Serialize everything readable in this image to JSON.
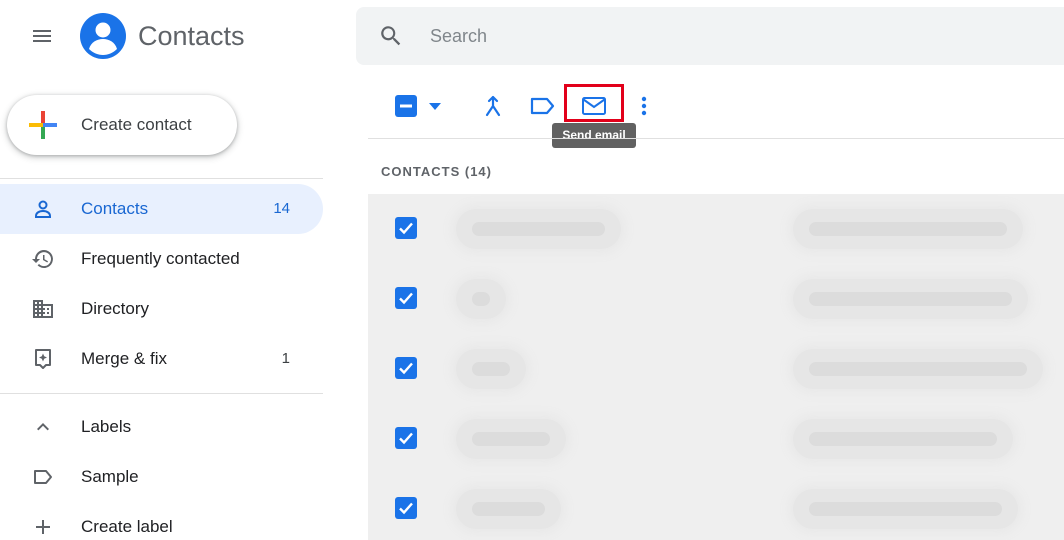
{
  "app": {
    "title": "Contacts"
  },
  "header": {
    "search_placeholder": "Search"
  },
  "sidebar": {
    "create_label": "Create contact",
    "items": [
      {
        "label": "Contacts",
        "count": "14",
        "icon": "person-icon",
        "active": true
      },
      {
        "label": "Frequently contacted",
        "count": "",
        "icon": "history-icon",
        "active": false
      },
      {
        "label": "Directory",
        "count": "",
        "icon": "building-icon",
        "active": false
      },
      {
        "label": "Merge & fix",
        "count": "1",
        "icon": "merge-fix-icon",
        "active": false
      }
    ],
    "labels_header": "Labels",
    "labels": [
      {
        "label": "Sample",
        "icon": "label-icon"
      }
    ],
    "create_label_text": "Create label"
  },
  "toolbar": {
    "tooltip": "Send email"
  },
  "main": {
    "section_header": "CONTACTS (14)",
    "rows": [
      {
        "checked": true,
        "redacted": true
      },
      {
        "checked": true,
        "redacted": true
      },
      {
        "checked": true,
        "redacted": true
      },
      {
        "checked": true,
        "redacted": true
      },
      {
        "checked": true,
        "redacted": true
      }
    ]
  },
  "colors": {
    "accent": "#1a73e8",
    "active_bg": "#e8f0fe",
    "highlight": "#e2001a",
    "tooltip_bg": "#616161"
  }
}
